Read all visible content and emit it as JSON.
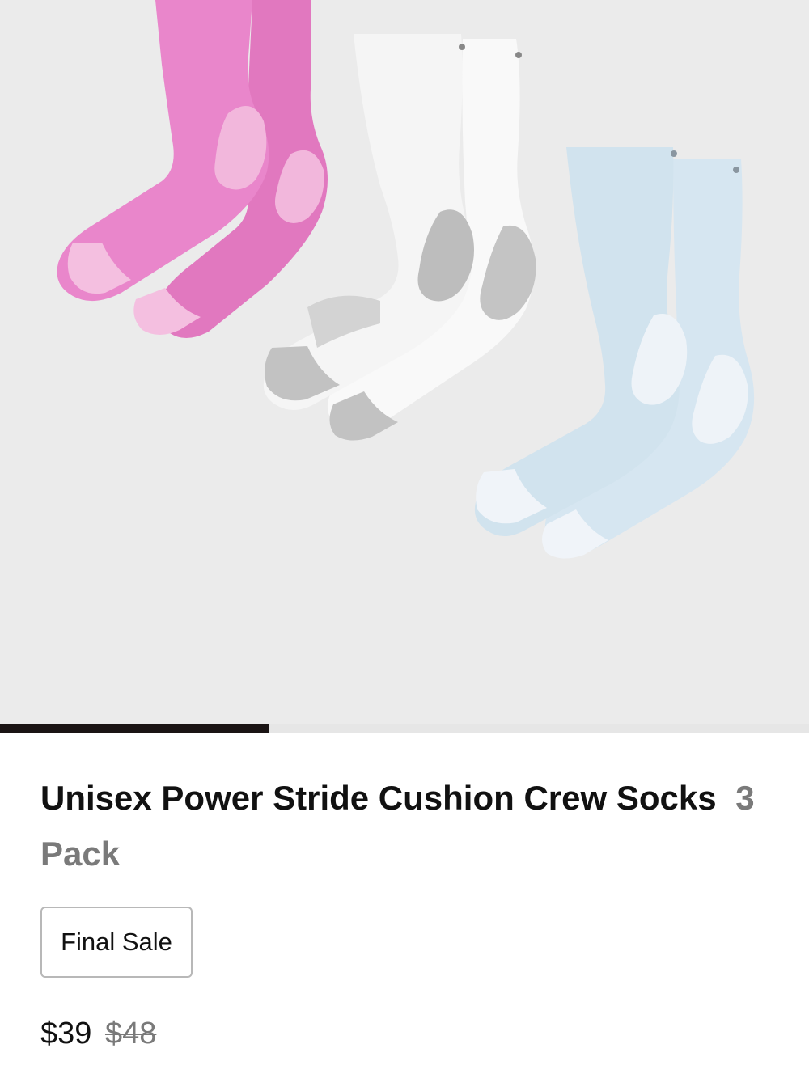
{
  "product": {
    "title": "Unisex Power Stride Cushion Crew Socks",
    "subtitle": "3 Pack",
    "badge": "Final Sale",
    "price_current": "$39",
    "price_original": "$48"
  },
  "gallery": {
    "progress": 0.333,
    "sock_colors": [
      "#e67cc6",
      "#f7f7f7",
      "#d4e5ef"
    ],
    "accent_colors": [
      "#f3b3dc",
      "#bcbcbc",
      "#eef3f8"
    ]
  },
  "colors": {
    "background": "#ebebeb",
    "progress_fill": "#1a1414",
    "progress_track": "#e6e6e6"
  }
}
